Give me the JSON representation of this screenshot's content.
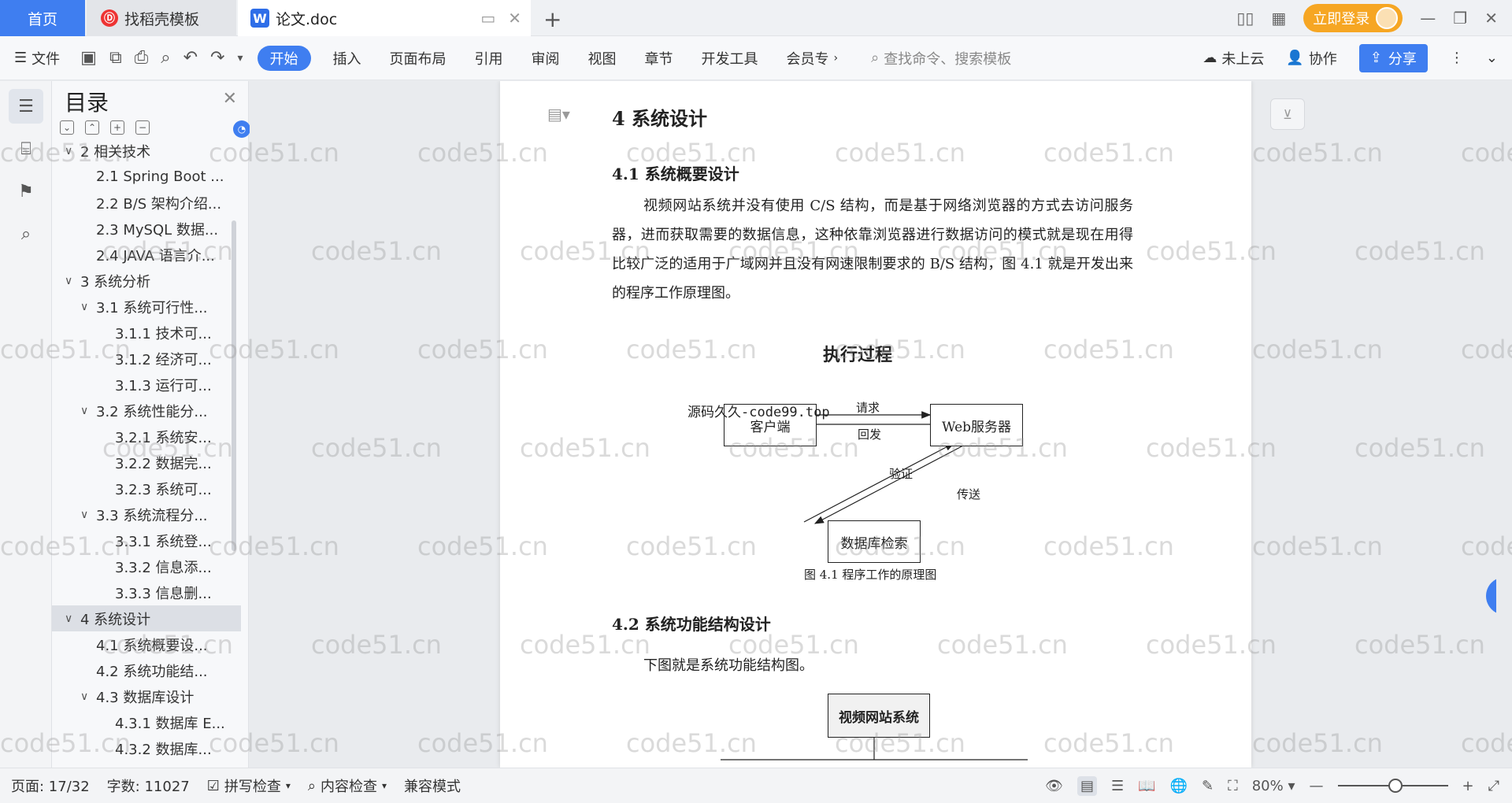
{
  "titlebar": {
    "tab_home": "首页",
    "tab_template": "找稻壳模板",
    "tab_doc": "论文.doc",
    "login": "立即登录"
  },
  "menubar": {
    "file": "文件",
    "items": [
      "开始",
      "插入",
      "页面布局",
      "引用",
      "审阅",
      "视图",
      "章节",
      "开发工具",
      "会员专"
    ],
    "search_placeholder": "查找命令、搜索模板",
    "cloud": "未上云",
    "collab": "协作",
    "share": "分享"
  },
  "toc": {
    "title": "目录",
    "items": [
      {
        "text": "2 相关技术",
        "level": 1,
        "chev": "﹀"
      },
      {
        "text": "2.1 Spring Boot ...",
        "level": 2,
        "chev": ""
      },
      {
        "text": "2.2 B/S 架构介绍...",
        "level": 2,
        "chev": ""
      },
      {
        "text": "2.3 MySQL 数据...",
        "level": 2,
        "chev": ""
      },
      {
        "text": "2.4 JAVA 语言介...",
        "level": 2,
        "chev": ""
      },
      {
        "text": "3  系统分析",
        "level": 1,
        "chev": "﹀"
      },
      {
        "text": "3.1 系统可行性...",
        "level": 2,
        "chev": "﹀"
      },
      {
        "text": "3.1.1  技术可...",
        "level": 3,
        "chev": ""
      },
      {
        "text": "3.1.2  经济可...",
        "level": 3,
        "chev": ""
      },
      {
        "text": "3.1.3  运行可...",
        "level": 3,
        "chev": ""
      },
      {
        "text": "3.2 系统性能分...",
        "level": 2,
        "chev": "﹀"
      },
      {
        "text": "3.2.1  系统安...",
        "level": 3,
        "chev": ""
      },
      {
        "text": "3.2.2  数据完...",
        "level": 3,
        "chev": ""
      },
      {
        "text": "3.2.3 系统可...",
        "level": 3,
        "chev": ""
      },
      {
        "text": "3.3 系统流程分...",
        "level": 2,
        "chev": "﹀"
      },
      {
        "text": "3.3.1 系统登...",
        "level": 3,
        "chev": ""
      },
      {
        "text": "3.3.2 信息添...",
        "level": 3,
        "chev": ""
      },
      {
        "text": "3.3.3 信息删...",
        "level": 3,
        "chev": ""
      },
      {
        "text": "4  系统设计",
        "level": 1,
        "chev": "﹀",
        "selected": true
      },
      {
        "text": "4.1 系统概要设...",
        "level": 2,
        "chev": ""
      },
      {
        "text": "4.2 系统功能结...",
        "level": 2,
        "chev": ""
      },
      {
        "text": "4.3 数据库设计",
        "level": 2,
        "chev": "﹀"
      },
      {
        "text": "4.3.1 数据库 E...",
        "level": 3,
        "chev": ""
      },
      {
        "text": "4.3.2  数据库...",
        "level": 3,
        "chev": ""
      }
    ]
  },
  "document": {
    "h1": "4  系统设计",
    "h2_1": "4.1 系统概要设计",
    "para1": "视频网站系统并没有使用 C/S 结构，而是基于网络浏览器的方式去访问服务器，进而获取需要的数据信息，这种依靠浏览器进行数据访问的模式就是现在用得比较广泛的适用于广域网并且没有网速限制要求的 B/S 结构，图 4.1 就是开发出来的程序工作原理图。",
    "fig_title": "执行过程",
    "client": "客户端",
    "server": "Web服务器",
    "db": "数据库检索",
    "req": "请求",
    "resp": "回发",
    "verify": "验证",
    "send": "传送",
    "overlay": "源码久久-code99.top",
    "caption": "图 4.1  程序工作的原理图",
    "h2_2": "4.2 系统功能结构设计",
    "para2": "下图就是系统功能结构图。",
    "root_box": "视频网站系统"
  },
  "watermark": "code51.cn",
  "statusbar": {
    "page": "页面: 17/32",
    "words": "字数: 11027",
    "spell": "拼写检查",
    "content": "内容检查",
    "compat": "兼容模式",
    "zoom": "80%",
    "zoom_fraction": 0.8
  },
  "icons": [
    "menu-icon",
    "save-icon",
    "undo-icon",
    "redo-icon",
    "search-icon",
    "cloud-icon",
    "collab-icon",
    "share-icon",
    "toc-icon",
    "bookmark-icon",
    "eye-icon",
    "zoom-in-icon",
    "zoom-out-icon",
    "fullscreen-icon"
  ]
}
